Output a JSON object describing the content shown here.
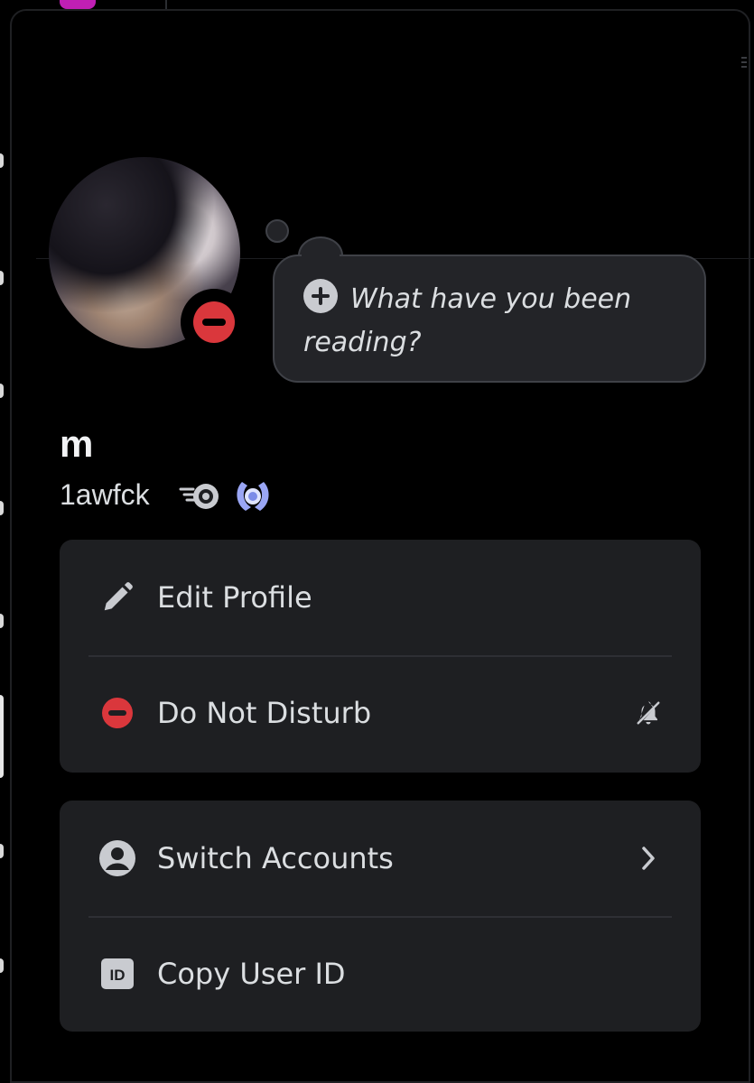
{
  "status_prompt": {
    "text": "What have you been reading?",
    "icon": "plus-circle-icon"
  },
  "profile": {
    "display_name": "m",
    "username": "1awfck",
    "status": "dnd",
    "status_color": "#da373c",
    "badges": [
      "nitro-speed-badge-icon",
      "hypesquad-laurel-badge-icon"
    ]
  },
  "menu": {
    "group_1": [
      {
        "label": "Edit Profile",
        "icon": "pencil-icon"
      },
      {
        "label": "Do Not Disturb",
        "icon": "dnd-status-icon",
        "trailing_icon": "bell-slash-icon"
      }
    ],
    "group_2": [
      {
        "label": "Switch Accounts",
        "icon": "user-circle-icon",
        "trailing_icon": "chevron-right-icon"
      },
      {
        "label": "Copy User ID",
        "icon": "id-badge-icon"
      }
    ]
  },
  "colors": {
    "background": "#000000",
    "card": "#1e1f22",
    "bubble": "#232428",
    "text": "#dbdee1",
    "dnd_red": "#da373c"
  }
}
